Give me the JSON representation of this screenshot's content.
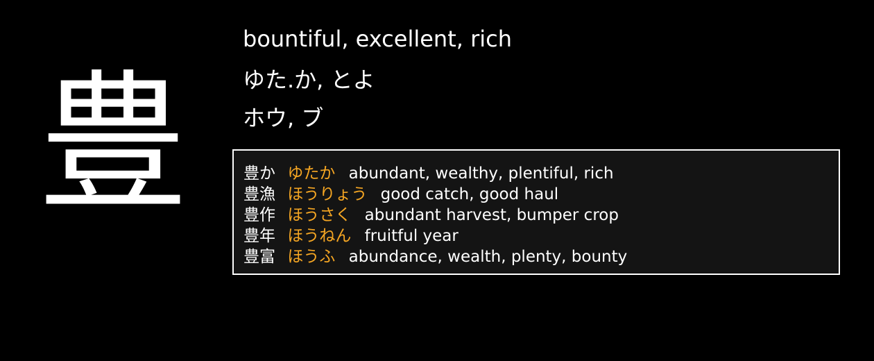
{
  "kanji": "豊",
  "meaning": "bountiful, excellent, rich",
  "kun_readings": "ゆた.か, とよ",
  "on_readings": "ホウ, ブ",
  "colors": {
    "background": "#000000",
    "text": "#ffffff",
    "reading_accent": "#f5a623",
    "box_background": "#141414",
    "box_border": "#ffffff"
  },
  "vocabulary": [
    {
      "word": "豊か",
      "reading": "ゆたか",
      "gloss": "abundant, wealthy, plentiful, rich"
    },
    {
      "word": "豊漁",
      "reading": "ほうりょう",
      "gloss": "good catch, good haul"
    },
    {
      "word": "豊作",
      "reading": "ほうさく",
      "gloss": "abundant harvest, bumper crop"
    },
    {
      "word": "豊年",
      "reading": "ほうねん",
      "gloss": "fruitful year"
    },
    {
      "word": "豊富",
      "reading": "ほうふ",
      "gloss": "abundance, wealth, plenty, bounty"
    }
  ]
}
